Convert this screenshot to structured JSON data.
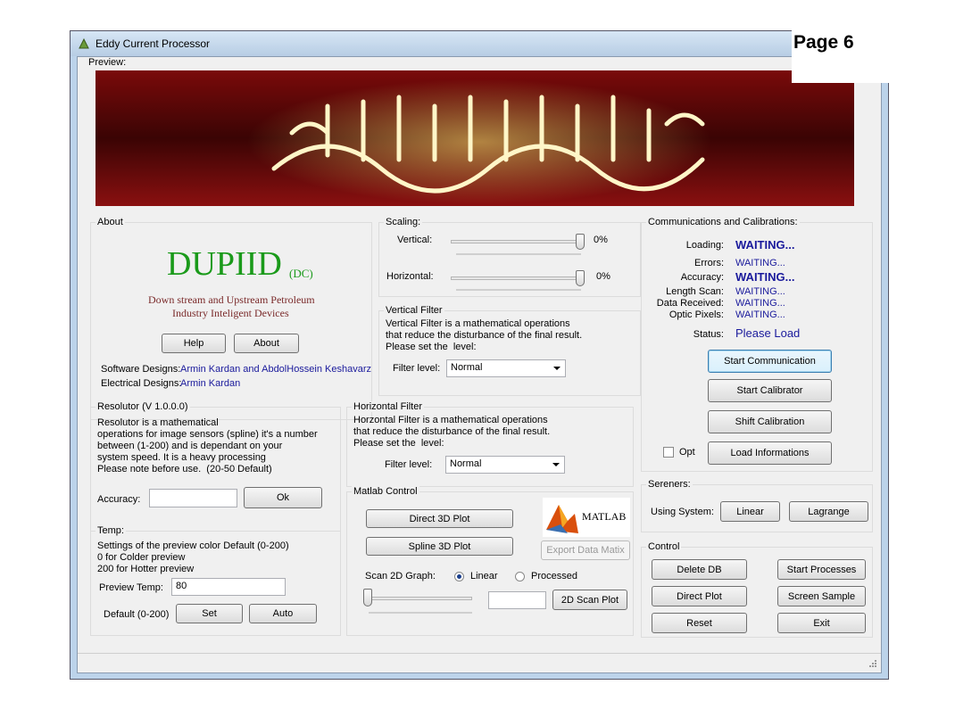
{
  "page_label": "Page 6",
  "window": {
    "title": "Eddy Current Processor"
  },
  "preview": {
    "label": "Preview:"
  },
  "about": {
    "title": "About",
    "logo_main": "DUPIID",
    "logo_sub": "(DC)",
    "tagline_1": "Down stream and Upstream Petroleum",
    "tagline_2": "Industry Inteligent Devices",
    "help_label": "Help",
    "about_label": "About",
    "software_label": "Software Designs:",
    "software_value": "Armin Kardan and AbdolHossein Keshavarz",
    "electrical_label": "Electrical Designs:",
    "electrical_value": "Armin Kardan"
  },
  "scaling": {
    "title": "Scaling:",
    "vertical_label": "Vertical:",
    "vertical_value": "0%",
    "vertical_level": 1.0,
    "horizontal_label": "Horizontal:",
    "horizontal_value": "0%",
    "horizontal_level": 1.0
  },
  "vertical_filter": {
    "title": "Vertical Filter",
    "description": "Vertical Filter is a mathematical operations\nthat reduce the disturbance of the final result.\nPlease set the  level:",
    "level_label": "Filter level:",
    "level_value": "Normal"
  },
  "horizontal_filter": {
    "title": "Horizontal Filter",
    "description": "Horzontal Filter is a mathematical operations\nthat reduce the disturbance of the final result.\nPlease set the  level:",
    "level_label": "Filter level:",
    "level_value": "Normal"
  },
  "communications": {
    "title": "Communications and Calibrations:",
    "loading_label": "Loading:",
    "loading_value": "WAITING...",
    "errors_label": "Errors:",
    "errors_value": "WAITING...",
    "accuracy_label": "Accuracy:",
    "accuracy_value": "WAITING...",
    "length_label": "Length Scan:",
    "length_value": "WAITING...",
    "data_label": "Data Received:",
    "data_value": "WAITING...",
    "optic_label": "Optic Pixels:",
    "optic_value": "WAITING...",
    "status_label": "Status:",
    "status_value": "Please Load",
    "start_comm": "Start Communication",
    "start_calib": "Start Calibrator",
    "shift_calib": "Shift Calibration",
    "opt_label": "Opt",
    "load_info": "Load Informations"
  },
  "resolutor": {
    "title": "Resolutor (V 1.0.0.0)",
    "description": "Resolutor is a mathematical\noperations for image sensors (spline) it's a number\nbetween (1-200) and is dependant on your\nsystem speed. It is a heavy processing\nPlease note before use.  (20-50 Default)",
    "accuracy_label": "Accuracy:",
    "accuracy_value": "",
    "ok_label": "Ok"
  },
  "temp": {
    "title": "Temp:",
    "description": "Settings of the preview color Default (0-200)\n0 for Colder preview\n200 for Hotter preview",
    "preview_label": "Preview Temp:",
    "preview_value": "80",
    "default_label": "Default (0-200)",
    "set_label": "Set",
    "auto_label": "Auto"
  },
  "matlab": {
    "title": "Matlab Control",
    "direct3d": "Direct 3D Plot",
    "spline3d": "Spline 3D Plot",
    "export": "Export Data Matix",
    "logo_text": "MATLAB",
    "scan_label": "Scan 2D Graph:",
    "radio_linear": "Linear",
    "radio_processed": "Processed",
    "scan_value": "",
    "scan_button": "2D Scan Plot"
  },
  "sereners": {
    "title": "Sereners:",
    "using_label": "Using System:",
    "linear": "Linear",
    "lagrange": "Lagrange"
  },
  "control": {
    "title": "Control",
    "delete_db": "Delete DB",
    "start_processes": "Start Processes",
    "direct_plot": "Direct Plot",
    "screen_sample": "Screen Sample",
    "reset": "Reset",
    "exit": "Exit"
  },
  "colors": {
    "title_green": "#1a9a1a",
    "tagline_brown": "#7a2a2a",
    "status_blue": "#1a1a9c"
  }
}
